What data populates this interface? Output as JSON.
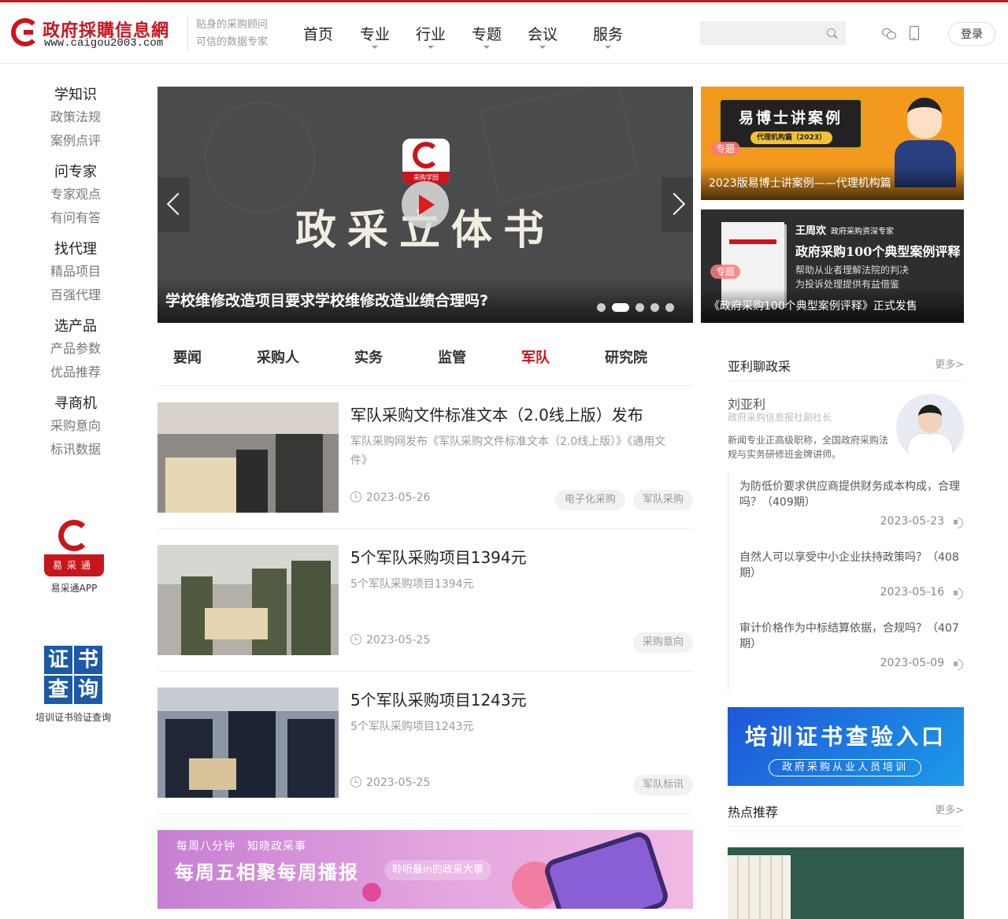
{
  "header": {
    "logo_cn": "政府採購信息網",
    "logo_en": "www.caigou2003.com",
    "slogan_1": "贴身的采购顾问",
    "slogan_2": "可信的数据专家",
    "nav": [
      {
        "label": "首页",
        "dropdown": false
      },
      {
        "label": "专业",
        "dropdown": true
      },
      {
        "label": "行业",
        "dropdown": true
      },
      {
        "label": "专题",
        "dropdown": true
      },
      {
        "label": "会议",
        "dropdown": true
      },
      {
        "label": "服务",
        "dropdown": true
      }
    ],
    "search_value": "",
    "login_label": "登录"
  },
  "sidenav": [
    {
      "title": "学知识",
      "links": [
        "政策法规",
        "案例点评"
      ]
    },
    {
      "title": "问专家",
      "links": [
        "专家观点",
        "有问有答"
      ]
    },
    {
      "title": "找代理",
      "links": [
        "精品项目",
        "百强代理"
      ]
    },
    {
      "title": "选产品",
      "links": [
        "产品参数",
        "优品推荐"
      ]
    },
    {
      "title": "寻商机",
      "links": [
        "采购意向",
        "标讯数据"
      ]
    }
  ],
  "app": {
    "badge": "易采通",
    "label": "易采通APP"
  },
  "cert": {
    "chars": [
      "证",
      "书",
      "查",
      "询"
    ],
    "label": "培训证书验证查询"
  },
  "hero": {
    "logo_badge": "采购学园",
    "big_text": "政采立体书",
    "caption": "学校维修改造项目要求学校维修改造业绩合理吗?",
    "slides": 5,
    "active_slide": 2
  },
  "promos": [
    {
      "board_title": "易博士讲案例",
      "board_sub": "代理机构篇（2023）",
      "tag": "专题",
      "caption": "2023版易博士讲案例——代理机构篇"
    },
    {
      "author": "王周欢",
      "author_role": "政府采购资深专家",
      "book_title": "政府采购100个典型案例评释",
      "desc_1": "帮助从业者理解法院的判决",
      "desc_2": "为投诉处理提供有益借鉴",
      "tag": "专题",
      "caption": "《政府采购100个典型案例评释》正式发售"
    }
  ],
  "tabs": [
    {
      "label": "要闻"
    },
    {
      "label": "采购人"
    },
    {
      "label": "实务"
    },
    {
      "label": "监管"
    },
    {
      "label": "军队",
      "active": true
    },
    {
      "label": "研究院"
    }
  ],
  "articles": [
    {
      "title": "军队采购文件标准文本（2.0线上版）发布",
      "summary": "军队采购网发布《军队采购文件标准文本（2.0线上版）》《通用文件》",
      "date": "2023-05-26",
      "tags": [
        "电子化采购",
        "军队采购"
      ]
    },
    {
      "title": "5个军队采购项目1394元",
      "summary": "5个军队采购项目1394元",
      "date": "2023-05-25",
      "tags": [
        "采购意向"
      ]
    },
    {
      "title": "5个军队采购项目1243元",
      "summary": "5个军队采购项目1243元",
      "date": "2023-05-25",
      "tags": [
        "军队标讯"
      ]
    }
  ],
  "week_banner": {
    "small": "每周八分钟　知晓政采事",
    "big": "每周五相聚每周播报",
    "pill": "聆听最in的政采大事"
  },
  "column": {
    "title": "亚利聊政采",
    "more": "更多>",
    "expert_name": "刘亚利",
    "expert_role": "政府采购信息报社副社长",
    "expert_desc": "新闻专业正高级职称，全国政府采购法规与实务研修班金牌讲师。",
    "items": [
      {
        "q": "为防低价要求供应商提供财务成本构成，合理吗？（409期）",
        "date": "2023-05-23"
      },
      {
        "q": "自然人可以享受中小企业扶持政策吗？（408期）",
        "date": "2023-05-16"
      },
      {
        "q": "审计价格作为中标结算依据，合规吗？（407期）",
        "date": "2023-05-09"
      }
    ]
  },
  "cert_banner": {
    "main": "培训证书查验入口",
    "sub": "政府采购从业人员培训"
  },
  "hot": {
    "title": "热点推荐",
    "more": "更多>"
  }
}
